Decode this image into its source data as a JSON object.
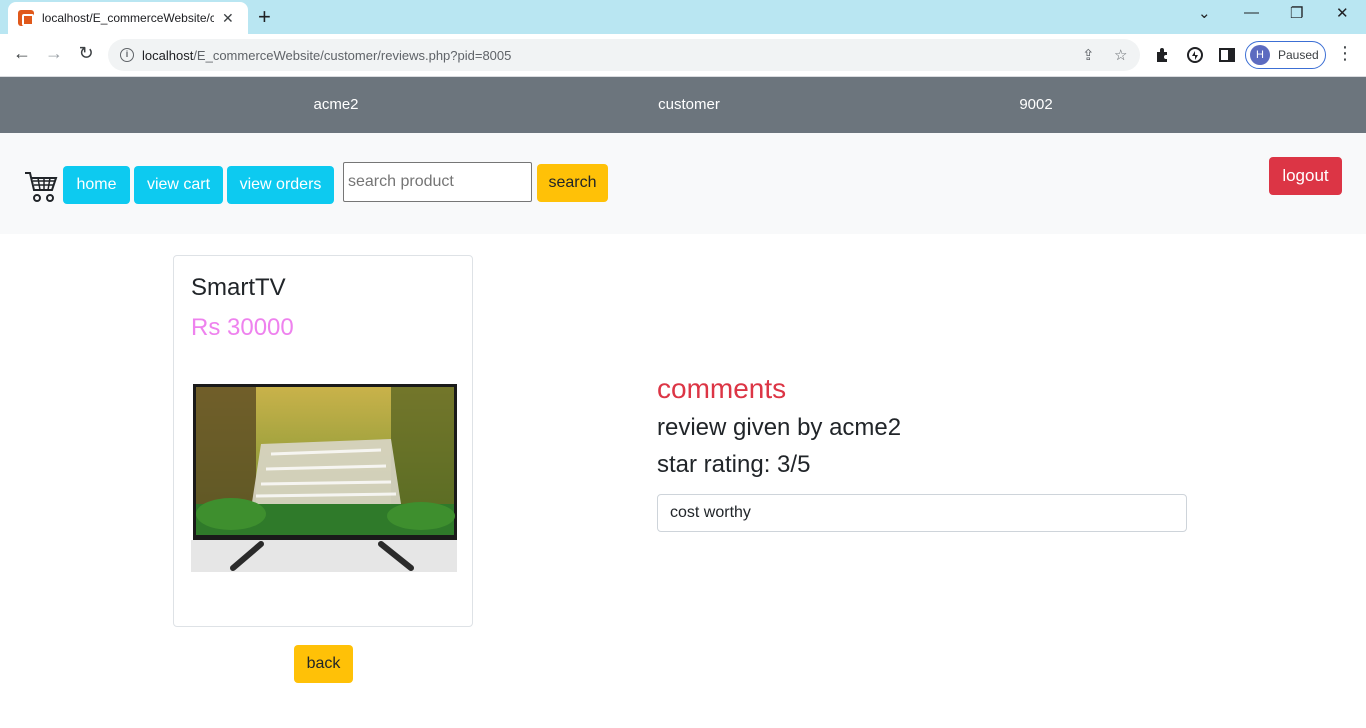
{
  "browser": {
    "tab_title": "localhost/E_commerceWebsite/cu",
    "new_tab": "+",
    "url_host": "localhost",
    "url_path": "/E_commerceWebsite/customer/reviews.php?pid=8005",
    "profile_initial": "H",
    "profile_status": "Paused"
  },
  "topinfo": {
    "username": "acme2",
    "role": "customer",
    "id": "9002"
  },
  "nav": {
    "home": "home",
    "view_cart": "view cart",
    "view_orders": "view orders",
    "search_placeholder": "search product",
    "search_button": "search",
    "logout": "logout"
  },
  "product": {
    "name": "SmartTV",
    "price": "Rs 30000"
  },
  "reviews": {
    "heading": "comments",
    "given_by": "review given by acme2",
    "rating": "star rating: 3/5",
    "comment": "cost worthy"
  },
  "back_button": "back",
  "colors": {
    "tabbar": "#b9e6f2",
    "topinfo_bg": "#6c757d",
    "info_button": "#0dcaf0",
    "warning_button": "#ffc107",
    "danger_button": "#dc3545",
    "price": "#ee82ee",
    "comments_heading": "#dc3545"
  }
}
